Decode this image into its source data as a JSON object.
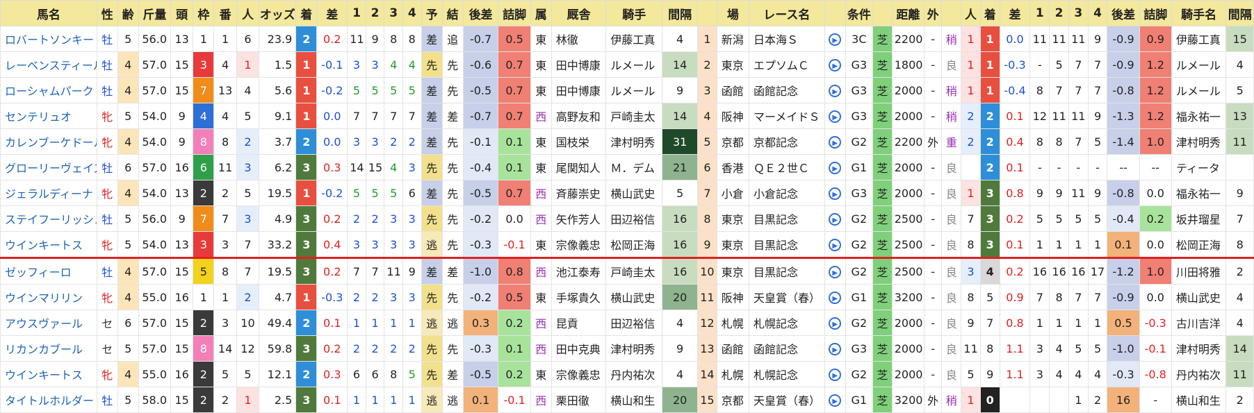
{
  "headers": [
    "馬名",
    "性",
    "齢",
    "斤量",
    "頭",
    "枠",
    "番",
    "人",
    "オッズ",
    "着",
    "差",
    "1",
    "2",
    "3",
    "4",
    "予",
    "結",
    "後差",
    "詰脚",
    "属",
    "厩舎",
    "騎手",
    "間隔",
    "",
    "場",
    "レース名",
    "",
    "条件",
    "",
    "距離",
    "外",
    "",
    "人",
    "着",
    "差",
    "1",
    "2",
    "3",
    "4",
    "後差",
    "詰脚",
    "騎手名",
    "間隔"
  ],
  "rows": [
    {
      "c": [
        "ロバートソンキー",
        "牡",
        "5",
        "56.0",
        "13",
        "1",
        "1",
        "6",
        "23.9",
        "2",
        "0.2",
        "11",
        "9",
        "8",
        "8",
        "差",
        "追",
        "-0.7",
        "0.5",
        "東",
        "林徹",
        "伊藤工真",
        "4",
        "1",
        "新潟",
        "日本海Ｓ",
        "",
        "3C",
        "芝",
        "2200",
        "-",
        "稍",
        "1",
        "1",
        "0.0",
        "11",
        "11",
        "11",
        "9",
        "-0.9",
        "0.9",
        "伊藤工真",
        "15"
      ]
    },
    {
      "c": [
        "レーベンスティール",
        "牡",
        "4",
        "57.0",
        "15",
        "3",
        "4",
        "1",
        "1.5",
        "1",
        "-0.1",
        "3",
        "3",
        "4",
        "4",
        "先",
        "先",
        "-0.6",
        "0.7",
        "東",
        "田中博康",
        "ルメール",
        "14",
        "2",
        "東京",
        "エプソムＣ",
        "",
        "G3",
        "芝",
        "1800",
        "-",
        "良",
        "1",
        "1",
        "-0.3",
        "-",
        "5",
        "7",
        "7",
        "-0.9",
        "1.2",
        "ルメール",
        "4"
      ]
    },
    {
      "c": [
        "ローシャムパーク",
        "牡",
        "4",
        "57.0",
        "15",
        "7",
        "13",
        "4",
        "5.6",
        "1",
        "-0.2",
        "5",
        "5",
        "5",
        "5",
        "差",
        "先",
        "-0.5",
        "0.7",
        "東",
        "田中博康",
        "ルメール",
        "9",
        "3",
        "函館",
        "函館記念",
        "",
        "G3",
        "芝",
        "2000",
        "-",
        "稍",
        "1",
        "1",
        "-0.4",
        "8",
        "7",
        "7",
        "7",
        "-0.8",
        "1.2",
        "ルメール",
        "5"
      ]
    },
    {
      "c": [
        "センテリュオ",
        "牝",
        "5",
        "54.0",
        "9",
        "4",
        "4",
        "5",
        "9.1",
        "1",
        "0.0",
        "7",
        "7",
        "7",
        "7",
        "差",
        "差",
        "-0.7",
        "0.7",
        "西",
        "高野友和",
        "戸崎圭太",
        "14",
        "4",
        "阪神",
        "マーメイドＳ",
        "",
        "G3",
        "芝",
        "2000",
        "-",
        "稍",
        "2",
        "2",
        "0.1",
        "12",
        "11",
        "11",
        "9",
        "-1.3",
        "1.2",
        "福永祐一",
        "13"
      ]
    },
    {
      "c": [
        "カレンブーケドール",
        "牝",
        "4",
        "54.0",
        "9",
        "8",
        "8",
        "2",
        "3.7",
        "2",
        "0.0",
        "3",
        "3",
        "2",
        "2",
        "差",
        "先",
        "-0.1",
        "0.1",
        "東",
        "国枝栄",
        "津村明秀",
        "31",
        "5",
        "京都",
        "京都記念",
        "",
        "G2",
        "芝",
        "2200",
        "外",
        "重",
        "2",
        "2",
        "0.4",
        "8",
        "8",
        "7",
        "5",
        "-1.4",
        "1.0",
        "津村明秀",
        "11"
      ]
    },
    {
      "c": [
        "グローリーヴェイズ",
        "牡",
        "6",
        "57.0",
        "16",
        "6",
        "11",
        "3",
        "6.2",
        "3",
        "0.3",
        "14",
        "15",
        "4",
        "3",
        "先",
        "先",
        "-0.4",
        "0.1",
        "東",
        "尾関知人",
        "Ｍ．デム",
        "21",
        "6",
        "香港",
        "ＱＥ２世Ｃ",
        "",
        "G1",
        "芝",
        "2000",
        "-",
        "良",
        "",
        "2",
        "0.1",
        "-",
        "-",
        "-",
        "-",
        "--",
        "--",
        "ティータ",
        ""
      ]
    },
    {
      "c": [
        "ジェラルディーナ",
        "牝",
        "4",
        "54.0",
        "13",
        "2",
        "2",
        "5",
        "19.5",
        "1",
        "-0.2",
        "5",
        "5",
        "5",
        "6",
        "差",
        "先",
        "-0.5",
        "0.7",
        "西",
        "斉藤崇史",
        "横山武史",
        "5",
        "7",
        "小倉",
        "小倉記念",
        "",
        "G3",
        "芝",
        "2000",
        "-",
        "良",
        "1",
        "3",
        "0.8",
        "9",
        "9",
        "11",
        "9",
        "-0.8",
        "0.0",
        "福永祐一",
        "9"
      ]
    },
    {
      "c": [
        "ステイフーリッシュ",
        "牡",
        "5",
        "56.0",
        "9",
        "7",
        "7",
        "3",
        "4.9",
        "3",
        "0.2",
        "2",
        "2",
        "3",
        "3",
        "先",
        "先",
        "-0.2",
        "0.0",
        "西",
        "矢作芳人",
        "田辺裕信",
        "16",
        "8",
        "東京",
        "目黒記念",
        "",
        "G2",
        "芝",
        "2500",
        "-",
        "良",
        "7",
        "3",
        "0.2",
        "5",
        "5",
        "5",
        "5",
        "-0.4",
        "0.2",
        "坂井瑠星",
        "7"
      ]
    },
    {
      "c": [
        "ウインキートス",
        "牝",
        "5",
        "54.0",
        "13",
        "3",
        "3",
        "7",
        "33.2",
        "3",
        "0.4",
        "3",
        "3",
        "3",
        "3",
        "逃",
        "先",
        "-0.3",
        "-0.1",
        "東",
        "宗像義忠",
        "松岡正海",
        "16",
        "9",
        "東京",
        "目黒記念",
        "",
        "G2",
        "芝",
        "2500",
        "-",
        "良",
        "8",
        "3",
        "0.1",
        "1",
        "1",
        "1",
        "1",
        "0.1",
        "0.0",
        "松岡正海",
        "8"
      ]
    },
    {
      "c": [
        "ゼッフィーロ",
        "牡",
        "4",
        "57.0",
        "15",
        "5",
        "8",
        "7",
        "19.5",
        "3",
        "0.2",
        "7",
        "7",
        "11",
        "9",
        "差",
        "差",
        "-1.0",
        "0.8",
        "西",
        "池江泰寿",
        "戸崎圭太",
        "16",
        "10",
        "東京",
        "目黒記念",
        "",
        "G2",
        "芝",
        "2500",
        "-",
        "良",
        "3",
        "4",
        "0.2",
        "16",
        "16",
        "16",
        "17",
        "-1.2",
        "1.0",
        "川田将雅",
        "2"
      ]
    },
    {
      "c": [
        "ウインマリリン",
        "牝",
        "4",
        "55.0",
        "16",
        "1",
        "1",
        "2",
        "4.7",
        "1",
        "-0.3",
        "2",
        "2",
        "3",
        "3",
        "先",
        "先",
        "-0.2",
        "0.5",
        "東",
        "手塚貴久",
        "横山武史",
        "20",
        "11",
        "阪神",
        "天皇賞（春）",
        "",
        "G1",
        "芝",
        "3200",
        "-",
        "良",
        "8",
        "5",
        "0.9",
        "7",
        "8",
        "7",
        "7",
        "-0.9",
        "0.0",
        "横山武史",
        "4"
      ]
    },
    {
      "c": [
        "アウスヴァール",
        "セ",
        "6",
        "57.0",
        "15",
        "2",
        "3",
        "10",
        "49.4",
        "2",
        "0.1",
        "1",
        "1",
        "1",
        "1",
        "逃",
        "逃",
        "0.3",
        "0.2",
        "西",
        "昆貢",
        "田辺裕信",
        "4",
        "12",
        "札幌",
        "札幌記念",
        "",
        "G2",
        "芝",
        "2000",
        "-",
        "良",
        "9",
        "7",
        "0.8",
        "1",
        "1",
        "1",
        "1",
        "0.5",
        "-0.3",
        "古川吉洋",
        "4"
      ]
    },
    {
      "c": [
        "リカンカブール",
        "セ",
        "5",
        "57.0",
        "15",
        "8",
        "14",
        "12",
        "59.8",
        "3",
        "0.2",
        "2",
        "2",
        "2",
        "2",
        "先",
        "先",
        "-0.3",
        "0.1",
        "西",
        "田中克典",
        "津村明秀",
        "9",
        "13",
        "函館",
        "函館記念",
        "",
        "G3",
        "芝",
        "2000",
        "-",
        "良",
        "11",
        "8",
        "1.1",
        "3",
        "4",
        "5",
        "5",
        "-1.0",
        "-0.1",
        "津村明秀",
        "14"
      ]
    },
    {
      "c": [
        "ウインキートス",
        "牝",
        "4",
        "55.0",
        "16",
        "2",
        "5",
        "5",
        "12.1",
        "2",
        "0.3",
        "6",
        "6",
        "8",
        "5",
        "先",
        "差",
        "-0.5",
        "0.2",
        "東",
        "宗像義忠",
        "丹内祐次",
        "4",
        "14",
        "札幌",
        "札幌記念",
        "",
        "G2",
        "芝",
        "2000",
        "-",
        "良",
        "5",
        "9",
        "1.1",
        "3",
        "4",
        "4",
        "4",
        "-0.3",
        "-0.8",
        "丹内祐次",
        "11"
      ]
    },
    {
      "c": [
        "タイトルホルダー",
        "牡",
        "5",
        "58.0",
        "15",
        "2",
        "2",
        "1",
        "2.5",
        "3",
        "0.1",
        "1",
        "1",
        "1",
        "1",
        "逃",
        "逃",
        "0.1",
        "-0.1",
        "西",
        "栗田徹",
        "横山和生",
        "20",
        "15",
        "京都",
        "天皇賞（春）",
        "",
        "G1",
        "芝",
        "3200",
        "外",
        "稍",
        "1",
        "0",
        "",
        "",
        "",
        "1",
        "2",
        "16",
        "-",
        "横山和生",
        "2"
      ]
    }
  ]
}
